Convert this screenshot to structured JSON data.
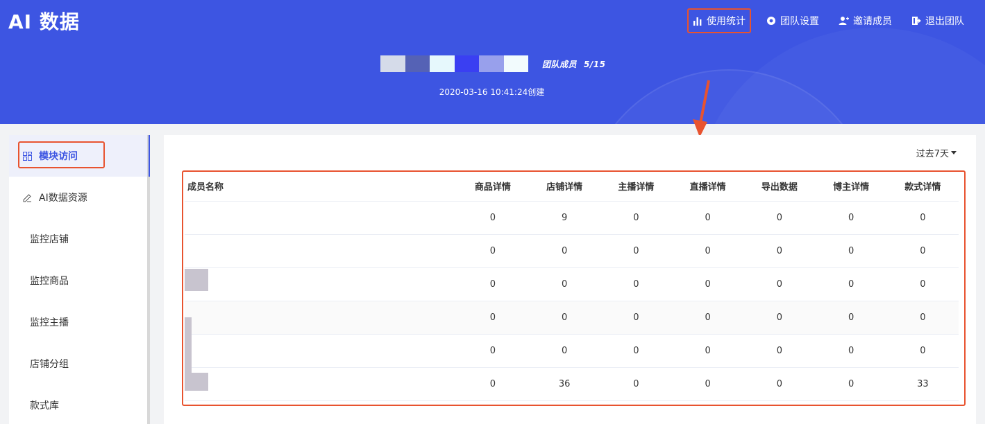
{
  "header": {
    "logo": "AI 数据",
    "nav": [
      {
        "label": "使用统计",
        "icon": "bar-chart-icon"
      },
      {
        "label": "团队设置",
        "icon": "gear-icon"
      },
      {
        "label": "邀请成员",
        "icon": "add-user-icon"
      },
      {
        "label": "退出团队",
        "icon": "exit-icon"
      }
    ],
    "team_count_label": "团队成员",
    "team_count_value": "5/15",
    "created": "2020-03-16 10:41:24创建",
    "colors": {
      "accent": "#3d55e2",
      "highlight": "#e8532f"
    }
  },
  "sidebar": {
    "items": [
      {
        "label": "模块访问",
        "icon": "grid-icon"
      },
      {
        "label": "AI数据资源",
        "icon": "edit-icon"
      },
      {
        "label": "监控店铺"
      },
      {
        "label": "监控商品"
      },
      {
        "label": "监控主播"
      },
      {
        "label": "店铺分组"
      },
      {
        "label": "款式库"
      }
    ]
  },
  "main": {
    "range_label": "过去7天",
    "table": {
      "columns": [
        "成员名称",
        "商品详情",
        "店铺详情",
        "主播详情",
        "直播详情",
        "导出数据",
        "博主详情",
        "款式详情"
      ],
      "rows": [
        {
          "name": "",
          "values": [
            "0",
            "9",
            "0",
            "0",
            "0",
            "0",
            "0"
          ]
        },
        {
          "name": "",
          "values": [
            "0",
            "0",
            "0",
            "0",
            "0",
            "0",
            "0"
          ]
        },
        {
          "name": "",
          "values": [
            "0",
            "0",
            "0",
            "0",
            "0",
            "0",
            "0"
          ]
        },
        {
          "name": "",
          "values": [
            "0",
            "0",
            "0",
            "0",
            "0",
            "0",
            "0"
          ]
        },
        {
          "name": "",
          "values": [
            "0",
            "0",
            "0",
            "0",
            "0",
            "0",
            "0"
          ]
        },
        {
          "name": "",
          "values": [
            "0",
            "36",
            "0",
            "0",
            "0",
            "0",
            "33"
          ]
        }
      ]
    }
  }
}
